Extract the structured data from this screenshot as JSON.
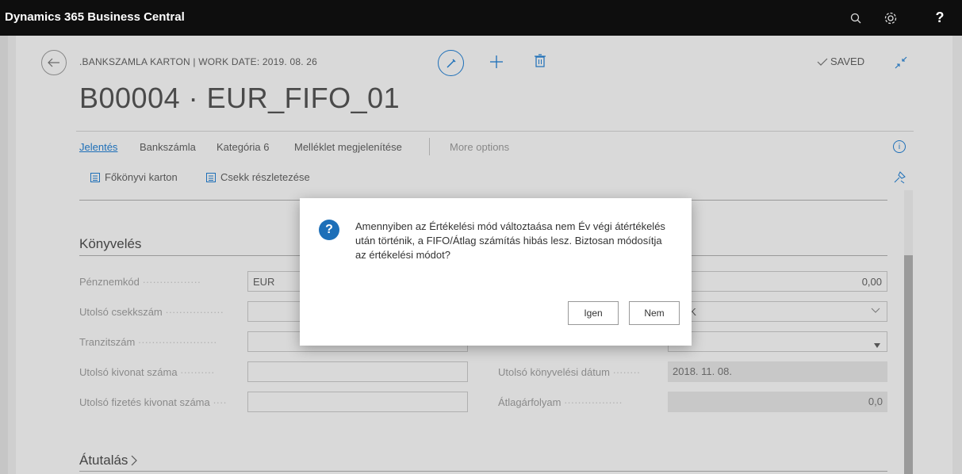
{
  "app": {
    "title": "Dynamics 365 Business Central"
  },
  "topbar": {
    "search_glyph": "⚲",
    "settings_glyph": "⚙",
    "help_label": "?"
  },
  "header": {
    "breadcrumb": ".BANKSZAMLA KARTON | WORK DATE: 2019. 08. 26",
    "record_title": "B00004 · EUR_FIFO_01",
    "saved_label": "SAVED"
  },
  "actionbar": {
    "tabs": [
      "Jelentés",
      "Bankszámla",
      "Kategória 6",
      "Melléklet megjelenítése"
    ],
    "more_options": "More options",
    "sub_actions": [
      "Főkönyvi karton",
      "Csekk részletezése"
    ]
  },
  "sections": {
    "posting": {
      "title": "Könyvelés",
      "left_fields": [
        {
          "label": "Pénznemkód",
          "value": "EUR"
        },
        {
          "label": "Utolsó csekkszám",
          "value": ""
        },
        {
          "label": "Tranzitszám",
          "value": ""
        },
        {
          "label": "Utolsó kivonat száma",
          "value": ""
        },
        {
          "label": "Utolsó fizetés kivonat száma",
          "value": ""
        }
      ],
      "right_fields": [
        {
          "label": "",
          "value": "0,00"
        },
        {
          "label": "",
          "value": "IZÁK"
        },
        {
          "label": "",
          "value": ""
        },
        {
          "label": "Utolsó könyvelési dátum",
          "value": "2018. 11. 08."
        },
        {
          "label": "Átlagárfolyam",
          "value": "0,0"
        }
      ]
    },
    "transfer": {
      "title": "Átutalás"
    }
  },
  "dialog": {
    "message": "Amennyiben az Értékelési mód változtaása nem Év végi átértékelés után történik, a FIFO/Átlag számítás hibás lesz. Biztosan módosítja az értékelési módot?",
    "icon_label": "?",
    "yes_label": "Igen",
    "no_label": "Nem"
  },
  "colors": {
    "accent": "#1d6fb8",
    "topbar": "#0e0e0e",
    "link": "#0f6cbd"
  }
}
